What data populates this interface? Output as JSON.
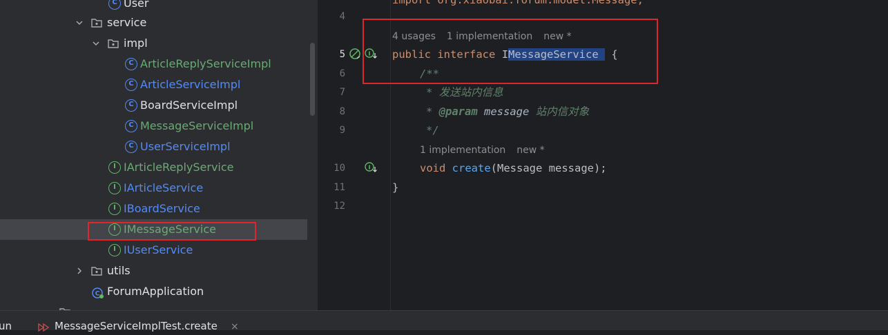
{
  "project_tree": {
    "items": [
      {
        "id": "user",
        "label": "User",
        "kind": "class",
        "color": "plain"
      },
      {
        "id": "service",
        "label": "service",
        "kind": "package",
        "expanded": true
      },
      {
        "id": "impl",
        "label": "impl",
        "kind": "package",
        "expanded": true
      },
      {
        "id": "articlereplyserviceimpl",
        "label": "ArticleReplyServiceImpl",
        "kind": "class",
        "color": "green"
      },
      {
        "id": "articleserviceimpl",
        "label": "ArticleServiceImpl",
        "kind": "class",
        "color": "blue"
      },
      {
        "id": "boardserviceimpl",
        "label": "BoardServiceImpl",
        "kind": "class",
        "color": "plain"
      },
      {
        "id": "messageserviceimpl",
        "label": "MessageServiceImpl",
        "kind": "class",
        "color": "green"
      },
      {
        "id": "userserviceimpl",
        "label": "UserServiceImpl",
        "kind": "class",
        "color": "blue"
      },
      {
        "id": "iarticlereplyservice",
        "label": "IArticleReplyService",
        "kind": "interface",
        "color": "green"
      },
      {
        "id": "iarticleservice",
        "label": "IArticleService",
        "kind": "interface",
        "color": "blue"
      },
      {
        "id": "iboardservice",
        "label": "IBoardService",
        "kind": "interface",
        "color": "blue"
      },
      {
        "id": "imessageservice",
        "label": "IMessageService",
        "kind": "interface",
        "color": "green",
        "selected": true
      },
      {
        "id": "iuserservice",
        "label": "IUserService",
        "kind": "interface",
        "color": "blue"
      },
      {
        "id": "utils",
        "label": "utils",
        "kind": "package",
        "expanded": false
      },
      {
        "id": "forumapplication",
        "label": "ForumApplication",
        "kind": "app",
        "color": "plain"
      }
    ]
  },
  "editor": {
    "line_numbers": [
      "4",
      "5",
      "6",
      "7",
      "8",
      "9",
      "10",
      "11",
      "12"
    ],
    "top_partial_line": "import org.xiaobai.forum.model.Message;",
    "inlay_interface": {
      "usages": "4 usages",
      "implementations": "1 implementation",
      "author": "new *"
    },
    "inlay_method": {
      "implementations": "1 implementation",
      "author": "new *"
    },
    "code": {
      "kw_public": "public",
      "kw_interface": "interface",
      "caret_char": "I",
      "selected_name": "MessageService ",
      "open_brace": " {",
      "doc_open": "/**",
      "doc_line1": "* 发送站内信息",
      "doc_star": "* ",
      "doc_param_tag": "@param",
      "doc_param_name": " message",
      "doc_param_desc": " 站内信对象",
      "doc_close": "*/",
      "kw_void": "void",
      "method_name": "create",
      "params": "(Message message);",
      "close_brace": "}"
    }
  },
  "bottom_bar": {
    "run_label": "un",
    "tab_label": "MessageServiceImplTest.create",
    "close_glyph": "×"
  },
  "colors": {
    "highlight_box": "#e0262b",
    "selection": "#214283",
    "keyword": "#cf8e6d",
    "function": "#56a8f5",
    "doc_comment": "#5f826b"
  }
}
